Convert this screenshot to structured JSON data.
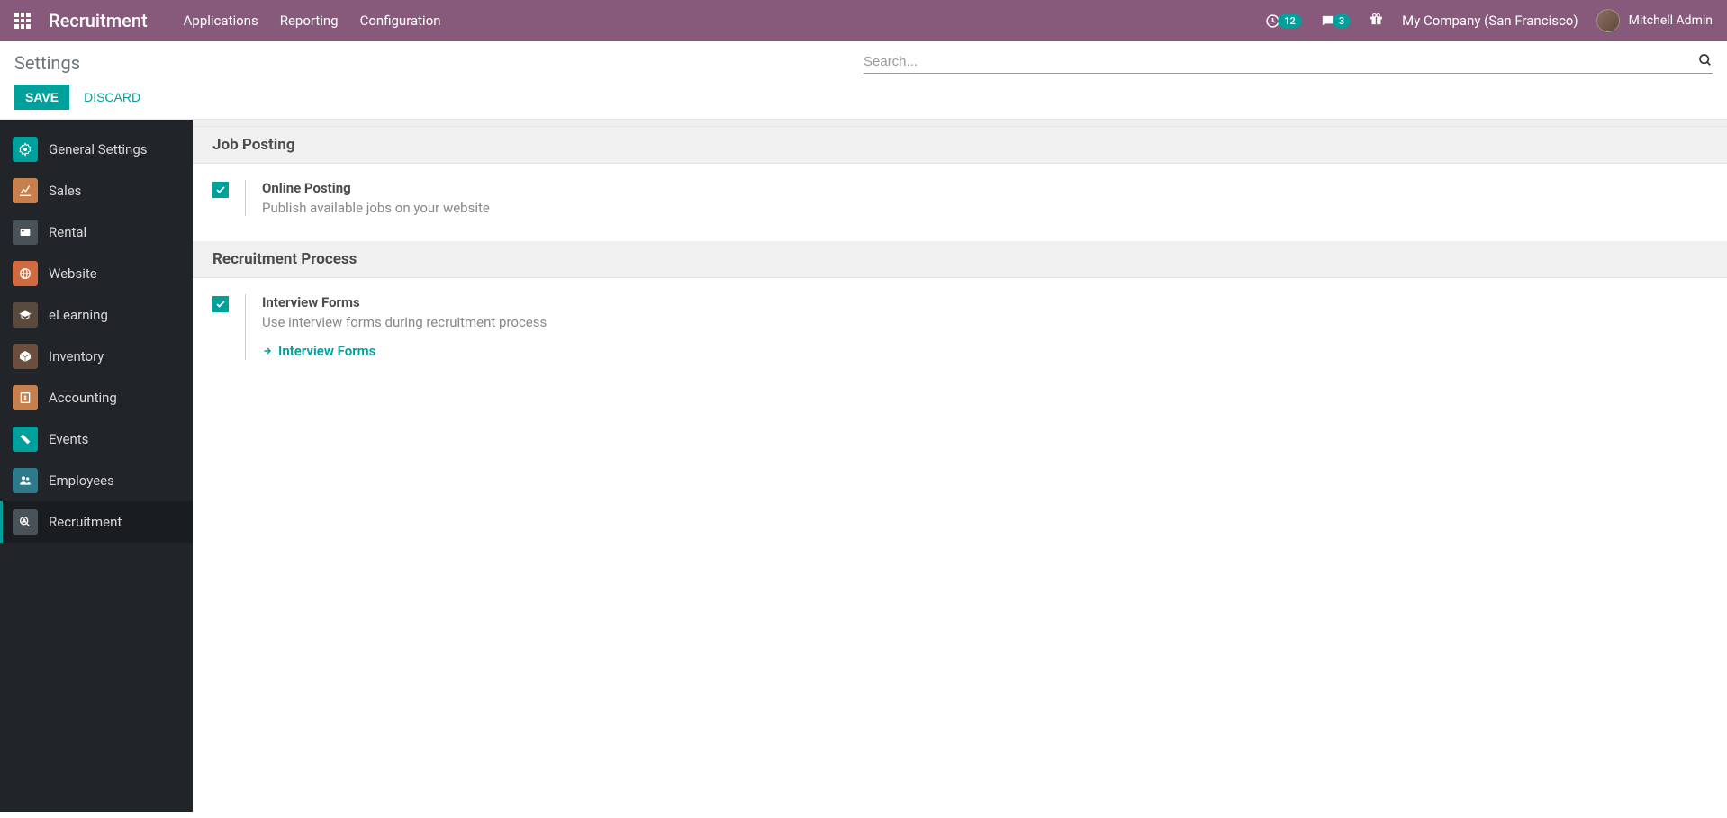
{
  "navbar": {
    "brand": "Recruitment",
    "menu": [
      {
        "label": "Applications"
      },
      {
        "label": "Reporting"
      },
      {
        "label": "Configuration"
      }
    ],
    "activity_count": "12",
    "message_count": "3",
    "company": "My Company (San Francisco)",
    "user": "Mitchell Admin"
  },
  "control_panel": {
    "breadcrumb": "Settings",
    "search_placeholder": "Search...",
    "save_label": "SAVE",
    "discard_label": "DISCARD"
  },
  "sidebar": {
    "items": [
      {
        "label": "General Settings",
        "icon_bg": "#00a09d"
      },
      {
        "label": "Sales",
        "icon_bg": "#c77f4d"
      },
      {
        "label": "Rental",
        "icon_bg": "#4a5259"
      },
      {
        "label": "Website",
        "icon_bg": "#d16b3f"
      },
      {
        "label": "eLearning",
        "icon_bg": "#5a4a3e"
      },
      {
        "label": "Inventory",
        "icon_bg": "#6b4e3d"
      },
      {
        "label": "Accounting",
        "icon_bg": "#c77f4d"
      },
      {
        "label": "Events",
        "icon_bg": "#00a09d"
      },
      {
        "label": "Employees",
        "icon_bg": "#2d7a8a"
      },
      {
        "label": "Recruitment",
        "icon_bg": "#4a5259"
      }
    ],
    "active_index": 9
  },
  "content": {
    "sections": [
      {
        "title": "Job Posting",
        "setting": {
          "checked": true,
          "title": "Online Posting",
          "desc": "Publish available jobs on your website"
        }
      },
      {
        "title": "Recruitment Process",
        "setting": {
          "checked": true,
          "title": "Interview Forms",
          "desc": "Use interview forms during recruitment process",
          "link": "Interview Forms"
        }
      }
    ]
  }
}
